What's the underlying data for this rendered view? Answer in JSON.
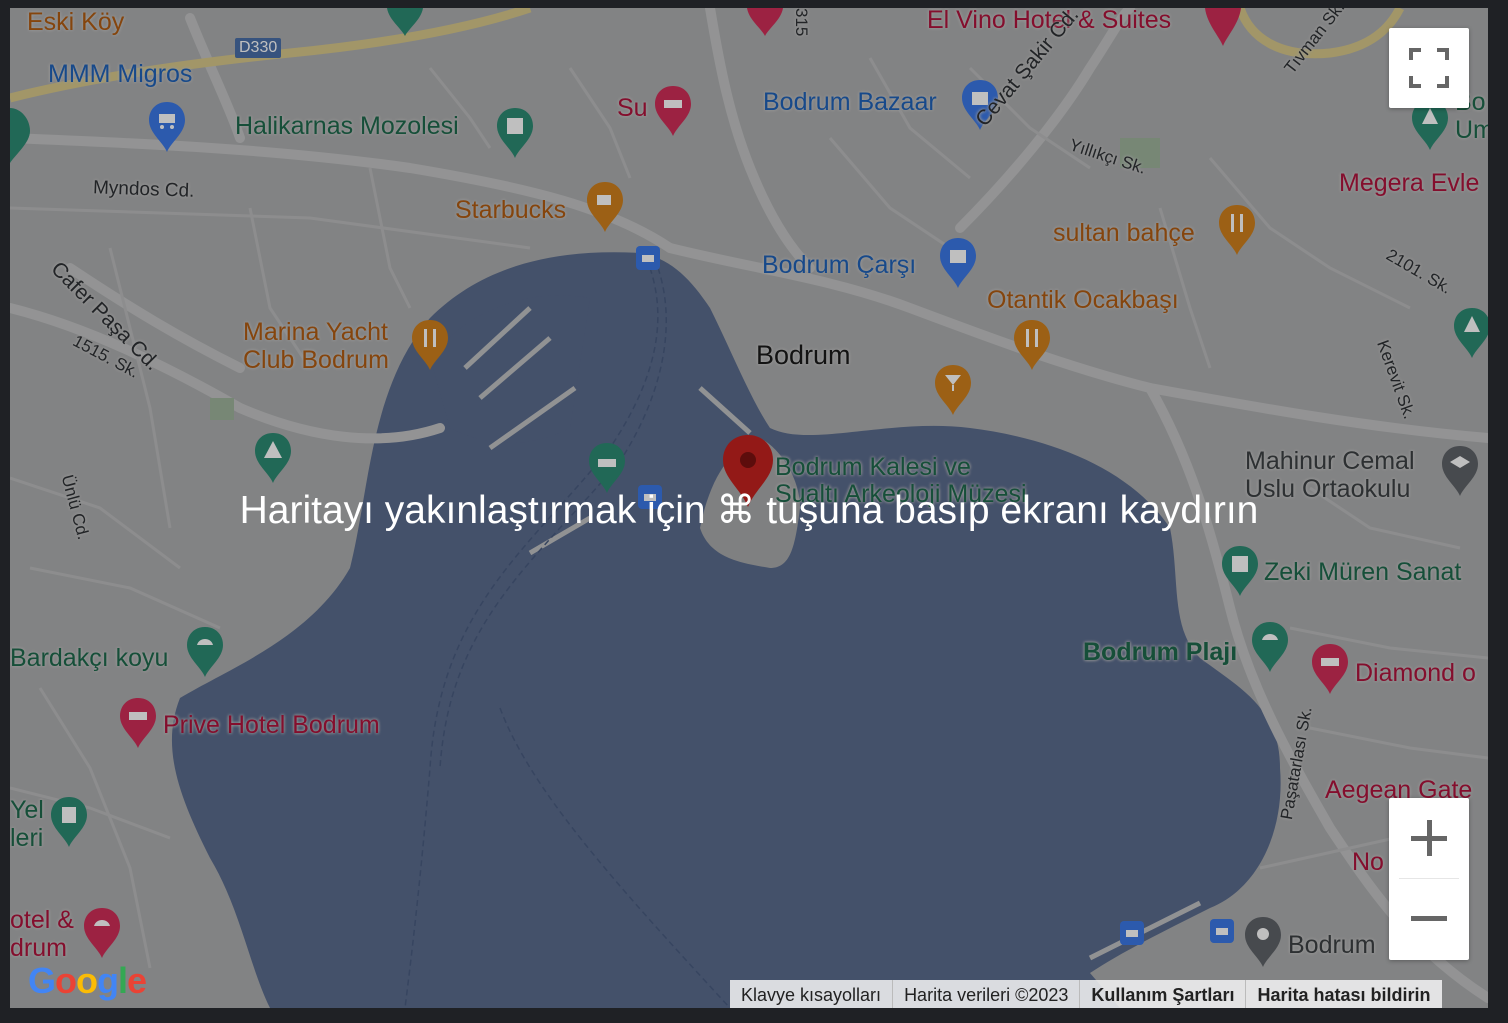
{
  "map": {
    "labels": {
      "eski_koy": "Eski Köy",
      "d330": "D330",
      "mmm_migros": "MMM Migros",
      "halikarnas": "Halikarnas Mozolesi",
      "myndos": "Myndos Cd.",
      "su": "Su",
      "el_vino": "El Vino Hotel & Suites",
      "bodrum_bazaar": "Bodrum Bazaar",
      "cevat_sakir": "Cevat Şakir Cd.",
      "tivman": "Tıvman Sk.",
      "yillikci": "Yıllıkçı Sk.",
      "megera": "Megera Evle",
      "starbucks": "Starbucks",
      "sultan_bahce": "sultan bahçe",
      "bodrum_carsi": "Bodrum Çarşı",
      "cafer_pasa": "Cafer Paşa Cd.",
      "sk_2101": "2101. Sk.",
      "otantik": "Otantik Ocakbaşı",
      "marina_1": "Marina Yacht",
      "marina_2": "Club Bodrum",
      "sk_1515": "1515. Sk.",
      "bodrum": "Bodrum",
      "kerevit": "Kerevit Sk.",
      "kalesi_1": "Bodrum Kalesi ve",
      "kalesi_2": "Sualtı Arkeoloji Müzesi",
      "mahinur_1": "Mahinur Cemal",
      "mahinur_2": "Uslu Ortaokulu",
      "unlu": "Ünlü Cd.",
      "zeki": "Zeki Müren Sanat",
      "bardakci": "Bardakçı koyu",
      "bodrum_plaji": "Bodrum Plajı",
      "diamond": "Diamond o",
      "prive": "Prive Hotel Bodrum",
      "pasatarlasi": "Paşatarlası Sk.",
      "aegean": "Aegean Gate",
      "yel_1": "Yel",
      "yel_2": "leri",
      "no": "No",
      "hotel_1": "otel &",
      "hotel_2": "drum",
      "bodrum_right": "Bodrum",
      "bo": "Bo",
      "um": "Um",
      "road_315": "315"
    },
    "overlay_message": "Haritayı yakınlaştırmak için ⌘ tuşuna basıp ekranı kaydırın",
    "controls": {
      "fullscreen_icon": "fullscreen-icon",
      "zoom_in_icon": "plus-icon",
      "zoom_out_icon": "minus-icon"
    },
    "attribution": {
      "shortcuts": "Klavye kısayolları",
      "data": "Harita verileri ©2023",
      "terms": "Kullanım Şartları",
      "report": "Harita hatası bildirin"
    },
    "logo_text": "Google",
    "colors": {
      "water": "#5a6c8e",
      "land": "#a9aaab",
      "pin": "#a52714",
      "logo_blue": "#4285f4",
      "logo_red": "#ea4335",
      "logo_yellow": "#fbbc05",
      "logo_green": "#34a853"
    }
  }
}
